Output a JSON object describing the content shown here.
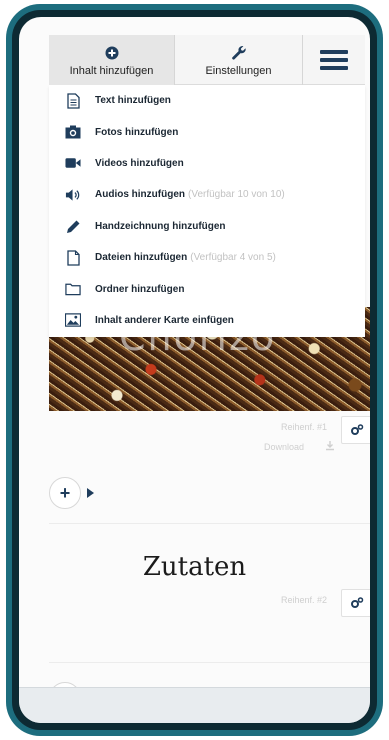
{
  "toolbar": {
    "add_content_label": "Inhalt hinzufügen",
    "settings_label": "Einstellungen",
    "add_icon": "plus-circle-icon",
    "settings_icon": "wrench-icon",
    "menu_icon": "hamburger-menu-icon"
  },
  "menu": {
    "items": [
      {
        "label": "Text hinzufügen",
        "note": "",
        "icon": "text-document-icon"
      },
      {
        "label": "Fotos hinzufügen",
        "note": "",
        "icon": "camera-icon"
      },
      {
        "label": "Videos hinzufügen",
        "note": "",
        "icon": "video-camera-icon"
      },
      {
        "label": "Audios hinzufügen",
        "note": "(Verfügbar 10 von 10)",
        "icon": "speaker-icon"
      },
      {
        "label": "Handzeichnung hinzufügen",
        "note": "",
        "icon": "pencil-icon"
      },
      {
        "label": "Dateien hinzufügen",
        "note": "(Verfügbar 4 von 5)",
        "icon": "file-icon"
      },
      {
        "label": "Ordner hinzufügen",
        "note": "",
        "icon": "folder-icon"
      },
      {
        "label": "Inhalt anderer Karte einfügen",
        "note": "",
        "icon": "image-icon"
      }
    ]
  },
  "content": {
    "image_overlay_text": "Chorizo",
    "row1_order": "Reihenf. #1",
    "row1_download": "Download",
    "section_heading": "Zutaten",
    "row2_order": "Reihenf. #2",
    "add_symbol": "+"
  },
  "colors": {
    "frame": "#1d6d7e",
    "accent": "#1f3d5c"
  }
}
